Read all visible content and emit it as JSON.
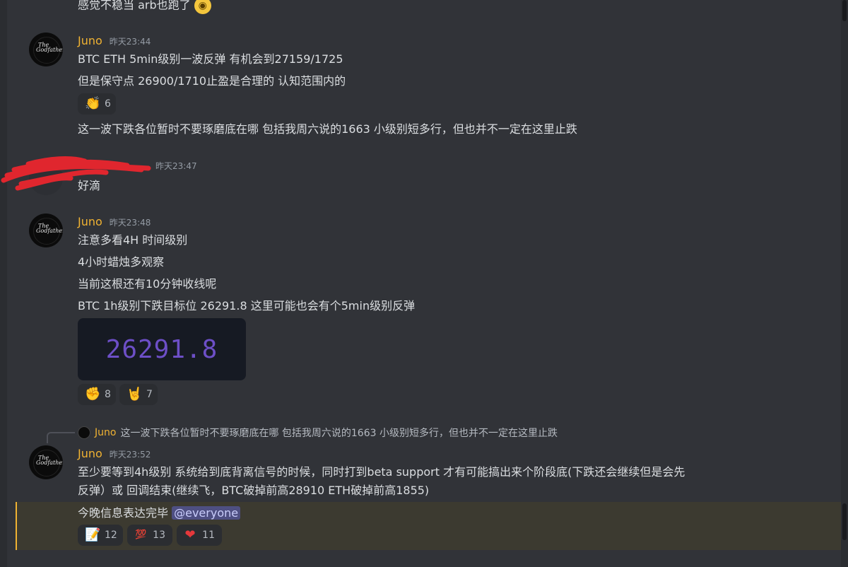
{
  "messages": [
    {
      "lines": [
        "感觉不稳当 arb也跑了"
      ]
    },
    {
      "author": "Juno",
      "time": "昨天23:44",
      "lines": [
        "BTC ETH 5min级别一波反弹 有机会到27159/1725",
        "但是保守点 26900/1710止盈是合理的 认知范围内的"
      ],
      "reactions": [
        {
          "icon": "clapping-hands-icon",
          "glyph": "👏",
          "count": "6"
        }
      ],
      "after_line": "这一波下跌各位暂时不要琢磨底在哪 包括我周六说的1663 小级别短多行，但也并不一定在这里止跌"
    },
    {
      "author": "",
      "time": "昨天23:47",
      "lines": [
        "好滴"
      ]
    },
    {
      "author": "Juno",
      "time": "昨天23:48",
      "lines": [
        "注意多看4H 时间级别",
        "4小时蜡烛多观察",
        "当前这根还有10分钟收线呢",
        "BTC 1h级别下跌目标位 26291.8   这里可能也会有个5min级别反弹"
      ],
      "image_text": "26291.8",
      "reactions": [
        {
          "icon": "raised-fist-icon",
          "glyph": "✊",
          "count": "8"
        },
        {
          "icon": "rock-hand-icon",
          "glyph": "🤘",
          "count": "7"
        }
      ]
    },
    {
      "reply": {
        "author": "Juno",
        "text": "这一波下跌各位暂时不要琢磨底在哪 包括我周六说的1663 小级别短多行，但也并不一定在这里止跌"
      },
      "author": "Juno",
      "time": "昨天23:52",
      "lines": [
        "至少要等到4h级别 系统给到底背离信号的时候，同时打到beta support 才有可能搞出来个阶段底(下跌还会继续但是会先",
        "反弹）或  回调结束(继续飞，BTC破掉前高28910 ETH破掉前高1855)"
      ],
      "mention_line": "今晚信息表达完毕",
      "mention_tag": "@everyone",
      "reactions": [
        {
          "icon": "memo-icon",
          "glyph": "📝",
          "count": "12"
        },
        {
          "icon": "hundred-points-icon",
          "glyph": "💯",
          "count": "13"
        },
        {
          "icon": "heart-icon",
          "glyph": "❤",
          "count": "11"
        }
      ]
    }
  ],
  "avatar_text": [
    "The",
    "Godfather"
  ],
  "colors": {
    "username": "#f0b232",
    "mention_bg": "#3c3a30",
    "background": "#313338"
  }
}
